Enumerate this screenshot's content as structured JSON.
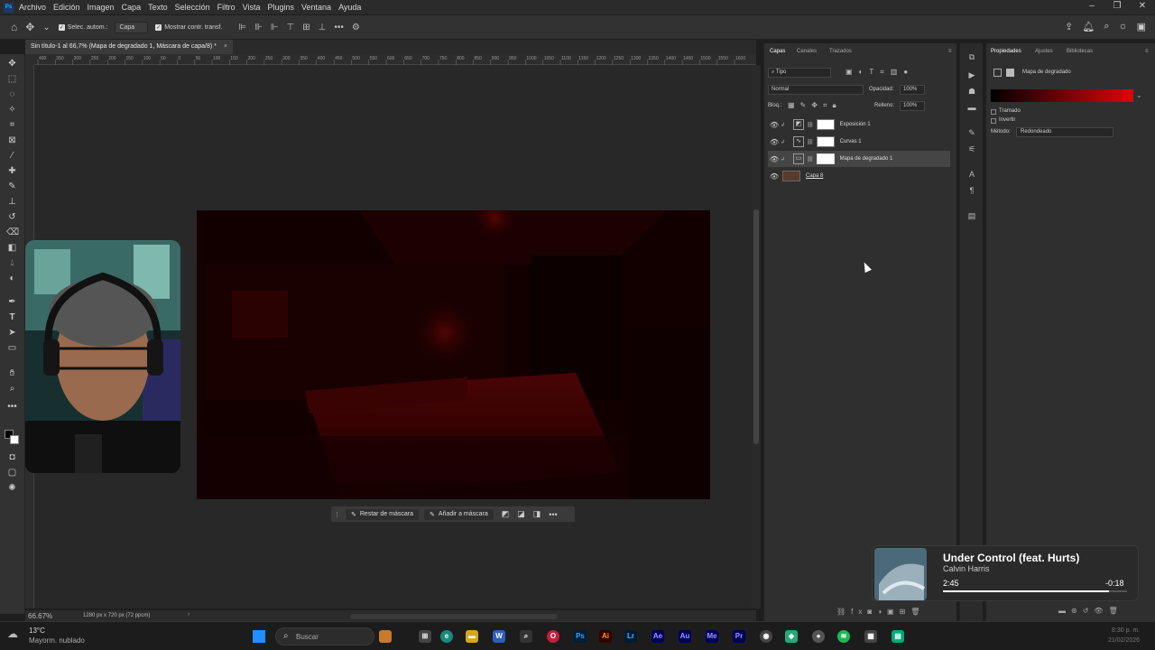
{
  "menubar": {
    "app_icon": "Ps",
    "items": [
      "Archivo",
      "Edición",
      "Imagen",
      "Capa",
      "Texto",
      "Selección",
      "Filtro",
      "Vista",
      "Plugins",
      "Ventana",
      "Ayuda"
    ]
  },
  "options_bar": {
    "auto_select_label": "Selec. autom.:",
    "auto_select_value": "Capa",
    "show_transform_label": "Mostrar contr. transf."
  },
  "document": {
    "tab_title": "Sin título-1 al 66,7% (Mapa de degradado 1, Máscara de capa/8) *",
    "ruler_ticks": [
      "400",
      "350",
      "300",
      "250",
      "200",
      "150",
      "100",
      "50",
      "0",
      "50",
      "100",
      "150",
      "200",
      "250",
      "300",
      "350",
      "400",
      "450",
      "500",
      "550",
      "600",
      "650",
      "700",
      "750",
      "800",
      "850",
      "900",
      "950",
      "1000",
      "1050",
      "1100",
      "1150",
      "1200",
      "1250",
      "1300",
      "1350",
      "1400",
      "1450",
      "1500",
      "1550",
      "1600"
    ],
    "zoom": "66.67%",
    "doc_size": "1280 px x 720 px (72 ppcm)"
  },
  "context_bar": {
    "subtract_label": "Restar de máscara",
    "add_label": "Añadir a máscara"
  },
  "layers_panel": {
    "tabs": [
      "Capas",
      "Canales",
      "Trazados"
    ],
    "filter_label": "Tipo",
    "blend_mode": "Normal",
    "opacity_label": "Opacidad:",
    "opacity_value": "100%",
    "lock_label": "Bloq.:",
    "fill_label": "Relleno:",
    "fill_value": "100%",
    "layers": [
      {
        "name": "Exposición 1",
        "selected": false
      },
      {
        "name": "Curvas 1",
        "selected": false
      },
      {
        "name": "Mapa de degradado 1",
        "selected": true
      },
      {
        "name": "Capa 8",
        "selected": false
      }
    ]
  },
  "properties_panel": {
    "tabs": [
      "Propiedades",
      "Ajustes",
      "Bibliotecas"
    ],
    "title": "Mapa de degradado",
    "gradient_colors": [
      "#000000",
      "#e00010"
    ],
    "dither_label": "Tramado",
    "invert_label": "Invertir",
    "method_label": "Método:",
    "method_value": "Redondeado"
  },
  "media_player": {
    "song": "Under Control (feat. Hurts)",
    "artist": "Calvin Harris",
    "elapsed": "2:45",
    "remaining": "-0:18",
    "progress": 0.9
  },
  "taskbar": {
    "weather_temp": "13°C",
    "weather_desc": "Mayorm. nublado",
    "search_placeholder": "Buscar",
    "time": "8:30 p. m.",
    "date": "21/02/2026"
  },
  "colors": {
    "accent_red": "#e00010",
    "panel_bg": "#2f2f2f",
    "workspace_bg": "#282828"
  }
}
